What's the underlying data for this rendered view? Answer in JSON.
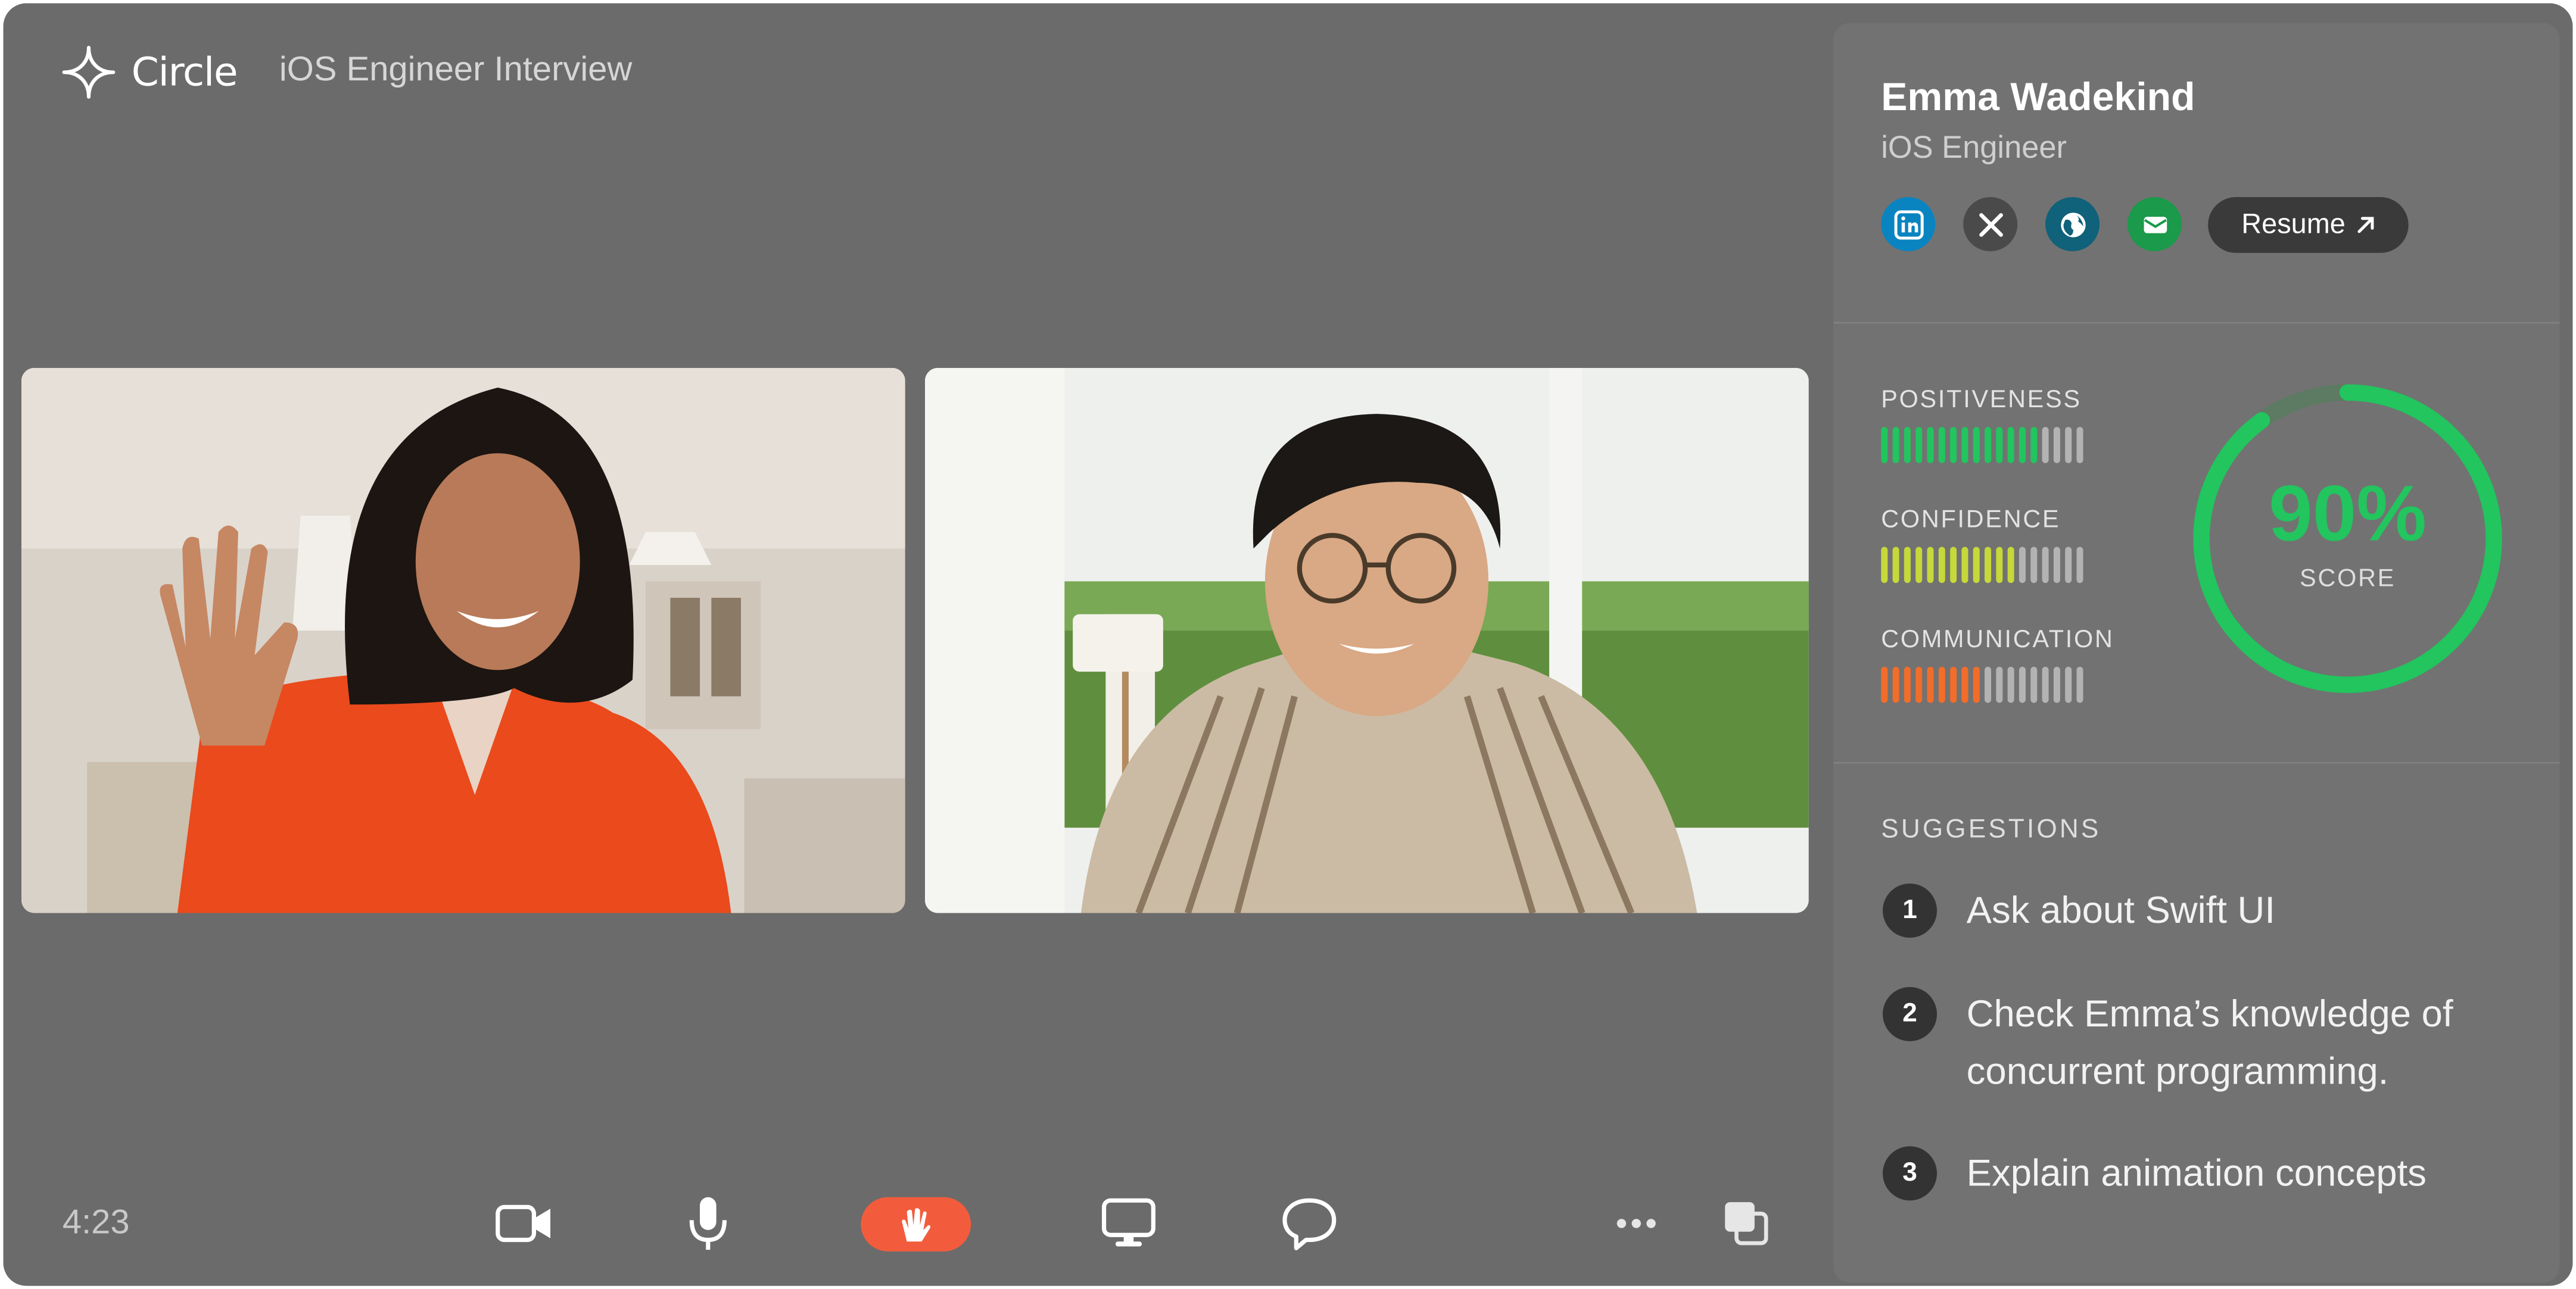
{
  "app": {
    "brand": "Circle",
    "meeting_title": "iOS Engineer Interview"
  },
  "call": {
    "timer": "4:23"
  },
  "participants": [
    {
      "name": "video-tile-woman"
    },
    {
      "name": "video-tile-man"
    }
  ],
  "toolbar": {
    "icons": [
      "video-camera-icon",
      "microphone-icon",
      "raise-hand-icon",
      "screen-share-icon",
      "chat-icon",
      "more-icon",
      "layout-icon"
    ]
  },
  "candidate": {
    "name": "Emma Wadekind",
    "role": "iOS Engineer",
    "resume_label": "Resume",
    "socials": [
      {
        "icon": "linkedin-icon",
        "color": "#0a84c0"
      },
      {
        "icon": "x-icon",
        "color": "#4a4a4a"
      },
      {
        "icon": "globe-icon",
        "color": "#10617a"
      },
      {
        "icon": "email-icon",
        "color": "#1a9a4a"
      }
    ]
  },
  "metrics": [
    {
      "label": "POSITIVENESS",
      "filled": 14,
      "total": 18,
      "color": "#22c55e"
    },
    {
      "label": "CONFIDENCE",
      "filled": 12,
      "total": 18,
      "color": "#c6d83a"
    },
    {
      "label": "COMMUNICATION",
      "filled": 9,
      "total": 18,
      "color": "#f26d2a"
    }
  ],
  "score": {
    "value": "90%",
    "label": "SCORE",
    "fraction": 0.9,
    "color": "#22c55e"
  },
  "suggestions": {
    "title": "SUGGESTIONS",
    "items": [
      {
        "num": "1",
        "text": "Ask about Swift UI"
      },
      {
        "num": "2",
        "text": "Check Emma’s knowledge of concurrent programming."
      },
      {
        "num": "3",
        "text": "Explain animation concepts"
      }
    ]
  }
}
